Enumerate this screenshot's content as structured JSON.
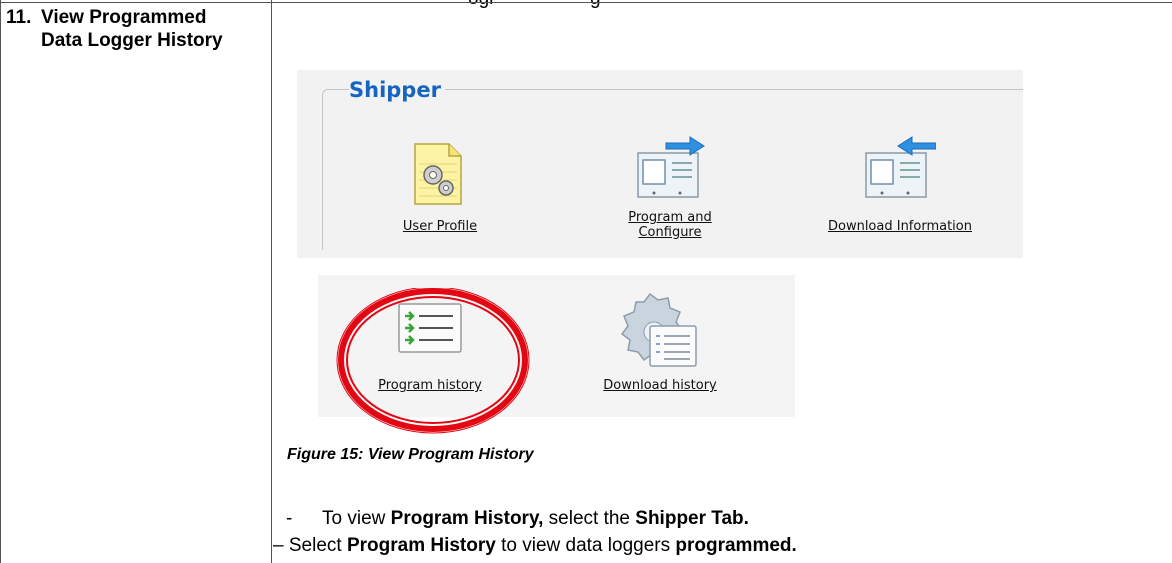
{
  "top_text": "ogr",
  "step": {
    "number": "11.",
    "title": "View Programmed Data Logger History"
  },
  "shipper": {
    "title": "Shipper",
    "items": [
      {
        "label": "User Profile",
        "icon": "user-profile-icon"
      },
      {
        "label": "Program and Configure",
        "icon": "program-configure-icon"
      },
      {
        "label": "Download Information",
        "icon": "download-information-icon"
      }
    ]
  },
  "history": {
    "items": [
      {
        "label": "Program history",
        "icon": "program-history-icon",
        "highlighted": true
      },
      {
        "label": "Download history",
        "icon": "download-history-icon"
      }
    ],
    "highlight_color": "#e30613"
  },
  "caption": "Figure 15: View Program History",
  "instructions": [
    {
      "dash": "-",
      "t1": "To view ",
      "b1": "Program History,",
      "t2": " select the ",
      "b2": "Shipper Tab."
    },
    {
      "dash": "–",
      "t1": "Select ",
      "b1": "Program History",
      "t2": " to view data loggers ",
      "b2": "programmed."
    }
  ],
  "colors": {
    "shipper_title": "#1565c0",
    "accent_blue": "#1e88e5"
  }
}
